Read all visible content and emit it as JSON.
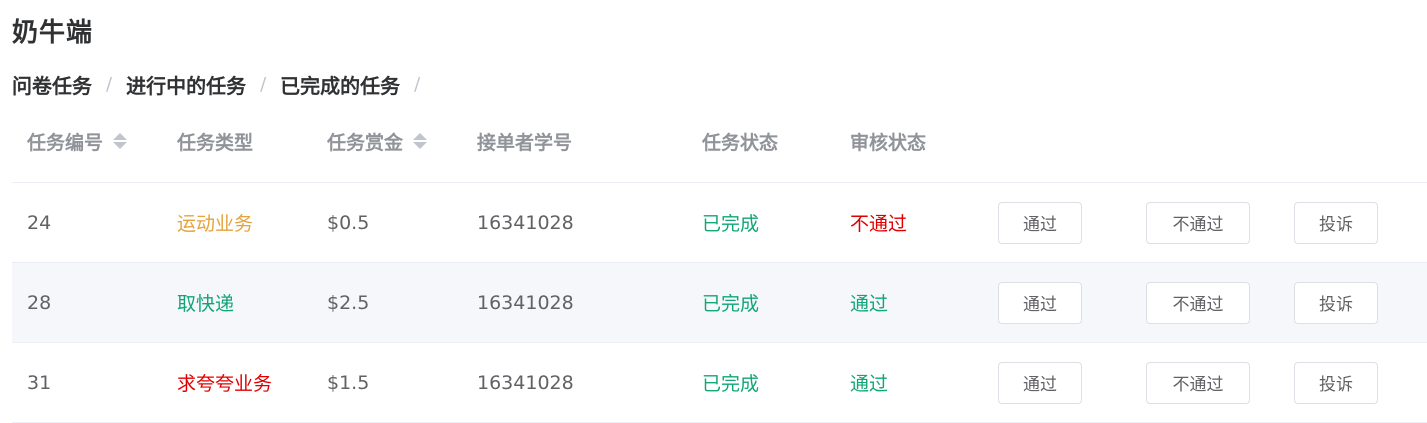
{
  "page": {
    "title": "奶牛端"
  },
  "breadcrumb": [
    {
      "label": "问卷任务"
    },
    {
      "label": "进行中的任务"
    },
    {
      "label": "已完成的任务"
    }
  ],
  "table": {
    "headers": [
      "任务编号",
      "任务类型",
      "任务赏金",
      "接单者学号",
      "任务状态",
      "审核状态"
    ],
    "sortable_columns": [
      "任务编号",
      "任务赏金"
    ],
    "rows": [
      {
        "id": "24",
        "type": "运动业务",
        "type_color": "#e6a23c",
        "bounty": "$0.5",
        "student_id": "16341028",
        "status": "已完成",
        "status_color": "#13a675",
        "review": "不通过",
        "review_color": "#e00000",
        "btn_pass": "通过",
        "btn_reject": "不通过",
        "btn_complain": "投诉"
      },
      {
        "id": "28",
        "type": "取快递",
        "type_color": "#13a675",
        "bounty": "$2.5",
        "student_id": "16341028",
        "status": "已完成",
        "status_color": "#13a675",
        "review": "通过",
        "review_color": "#13a675",
        "btn_pass": "通过",
        "btn_reject": "不通过",
        "btn_complain": "投诉"
      },
      {
        "id": "31",
        "type": "求夸夸业务",
        "type_color": "#e00000",
        "bounty": "$1.5",
        "student_id": "16341028",
        "status": "已完成",
        "status_color": "#13a675",
        "review": "通过",
        "review_color": "#13a675",
        "btn_pass": "通过",
        "btn_reject": "不通过",
        "btn_complain": "投诉"
      }
    ]
  },
  "icons": {
    "sort": "sort-caret-icon"
  }
}
